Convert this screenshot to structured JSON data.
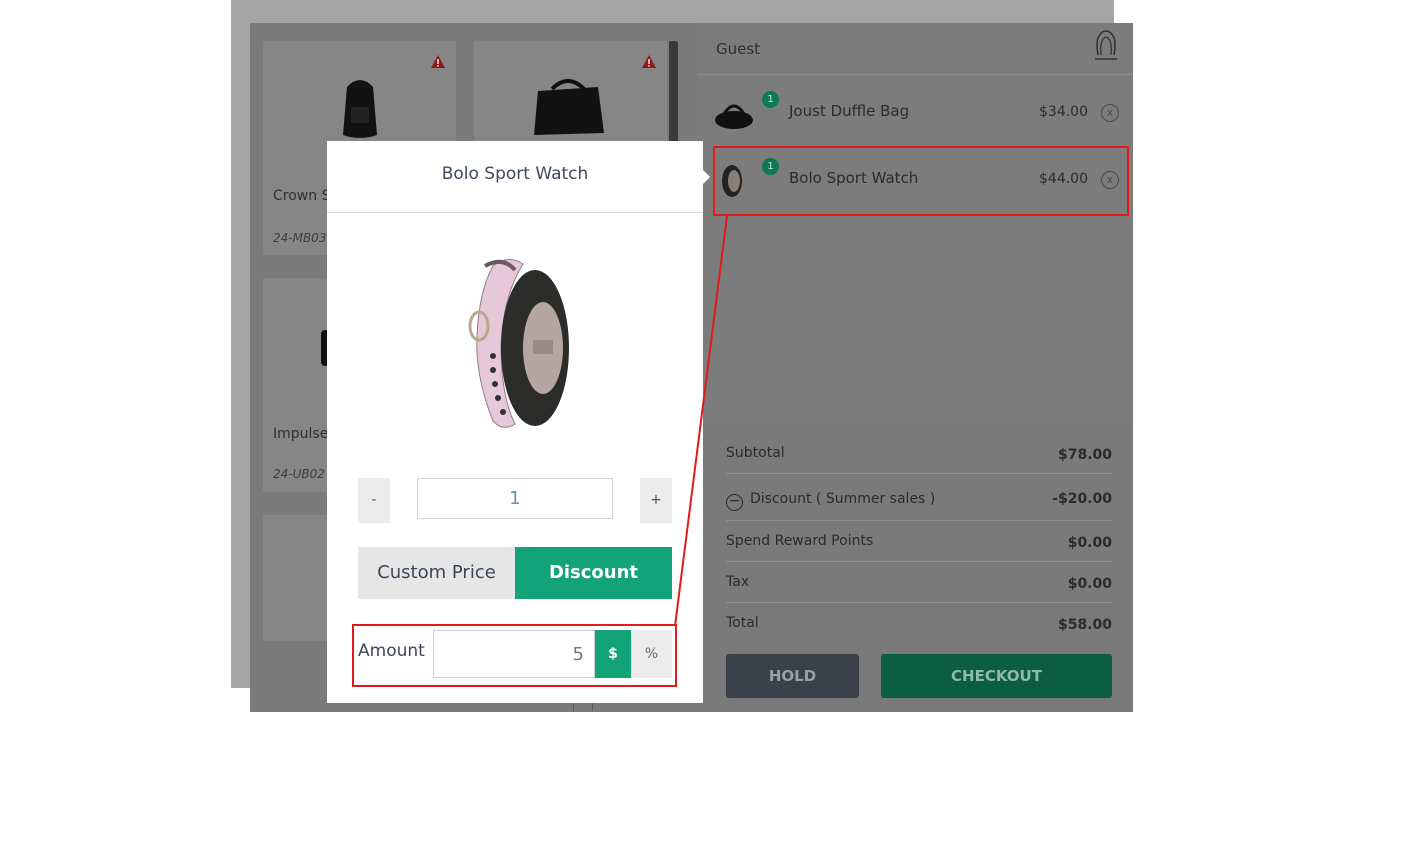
{
  "products": [
    {
      "name": "Crown S",
      "sku": "24-MB03"
    },
    {
      "name": "",
      "sku": ""
    },
    {
      "name": "Impulse",
      "sku": "24-UB02"
    }
  ],
  "cart": {
    "customer": "Guest",
    "items": [
      {
        "name": "Joust Duffle Bag",
        "qty": "1",
        "price": "$34.00",
        "remove_icon": "x"
      },
      {
        "name": "Bolo Sport Watch",
        "qty": "1",
        "price": "$44.00",
        "remove_icon": "x"
      }
    ],
    "summary": {
      "subtotal_label": "Subtotal",
      "subtotal": "$78.00",
      "discount_label": "Discount ( Summer sales )",
      "discount": "-$20.00",
      "reward_label": "Spend Reward Points",
      "reward": "$0.00",
      "tax_label": "Tax",
      "tax": "$0.00",
      "total_label": "Total",
      "total": "$58.00"
    },
    "hold_label": "HOLD",
    "checkout_label": "CHECKOUT"
  },
  "popup": {
    "title": "Bolo Sport Watch",
    "decrement": "-",
    "increment": "+",
    "quantity": "1",
    "custom_price_tab": "Custom Price",
    "discount_tab": "Discount",
    "amount_label": "Amount",
    "amount_value": "5",
    "currency_symbol": "$",
    "percent_symbol": "%"
  },
  "colors": {
    "accent": "#12a378",
    "highlight": "#e11a1a",
    "badge": "#0b7a55"
  }
}
